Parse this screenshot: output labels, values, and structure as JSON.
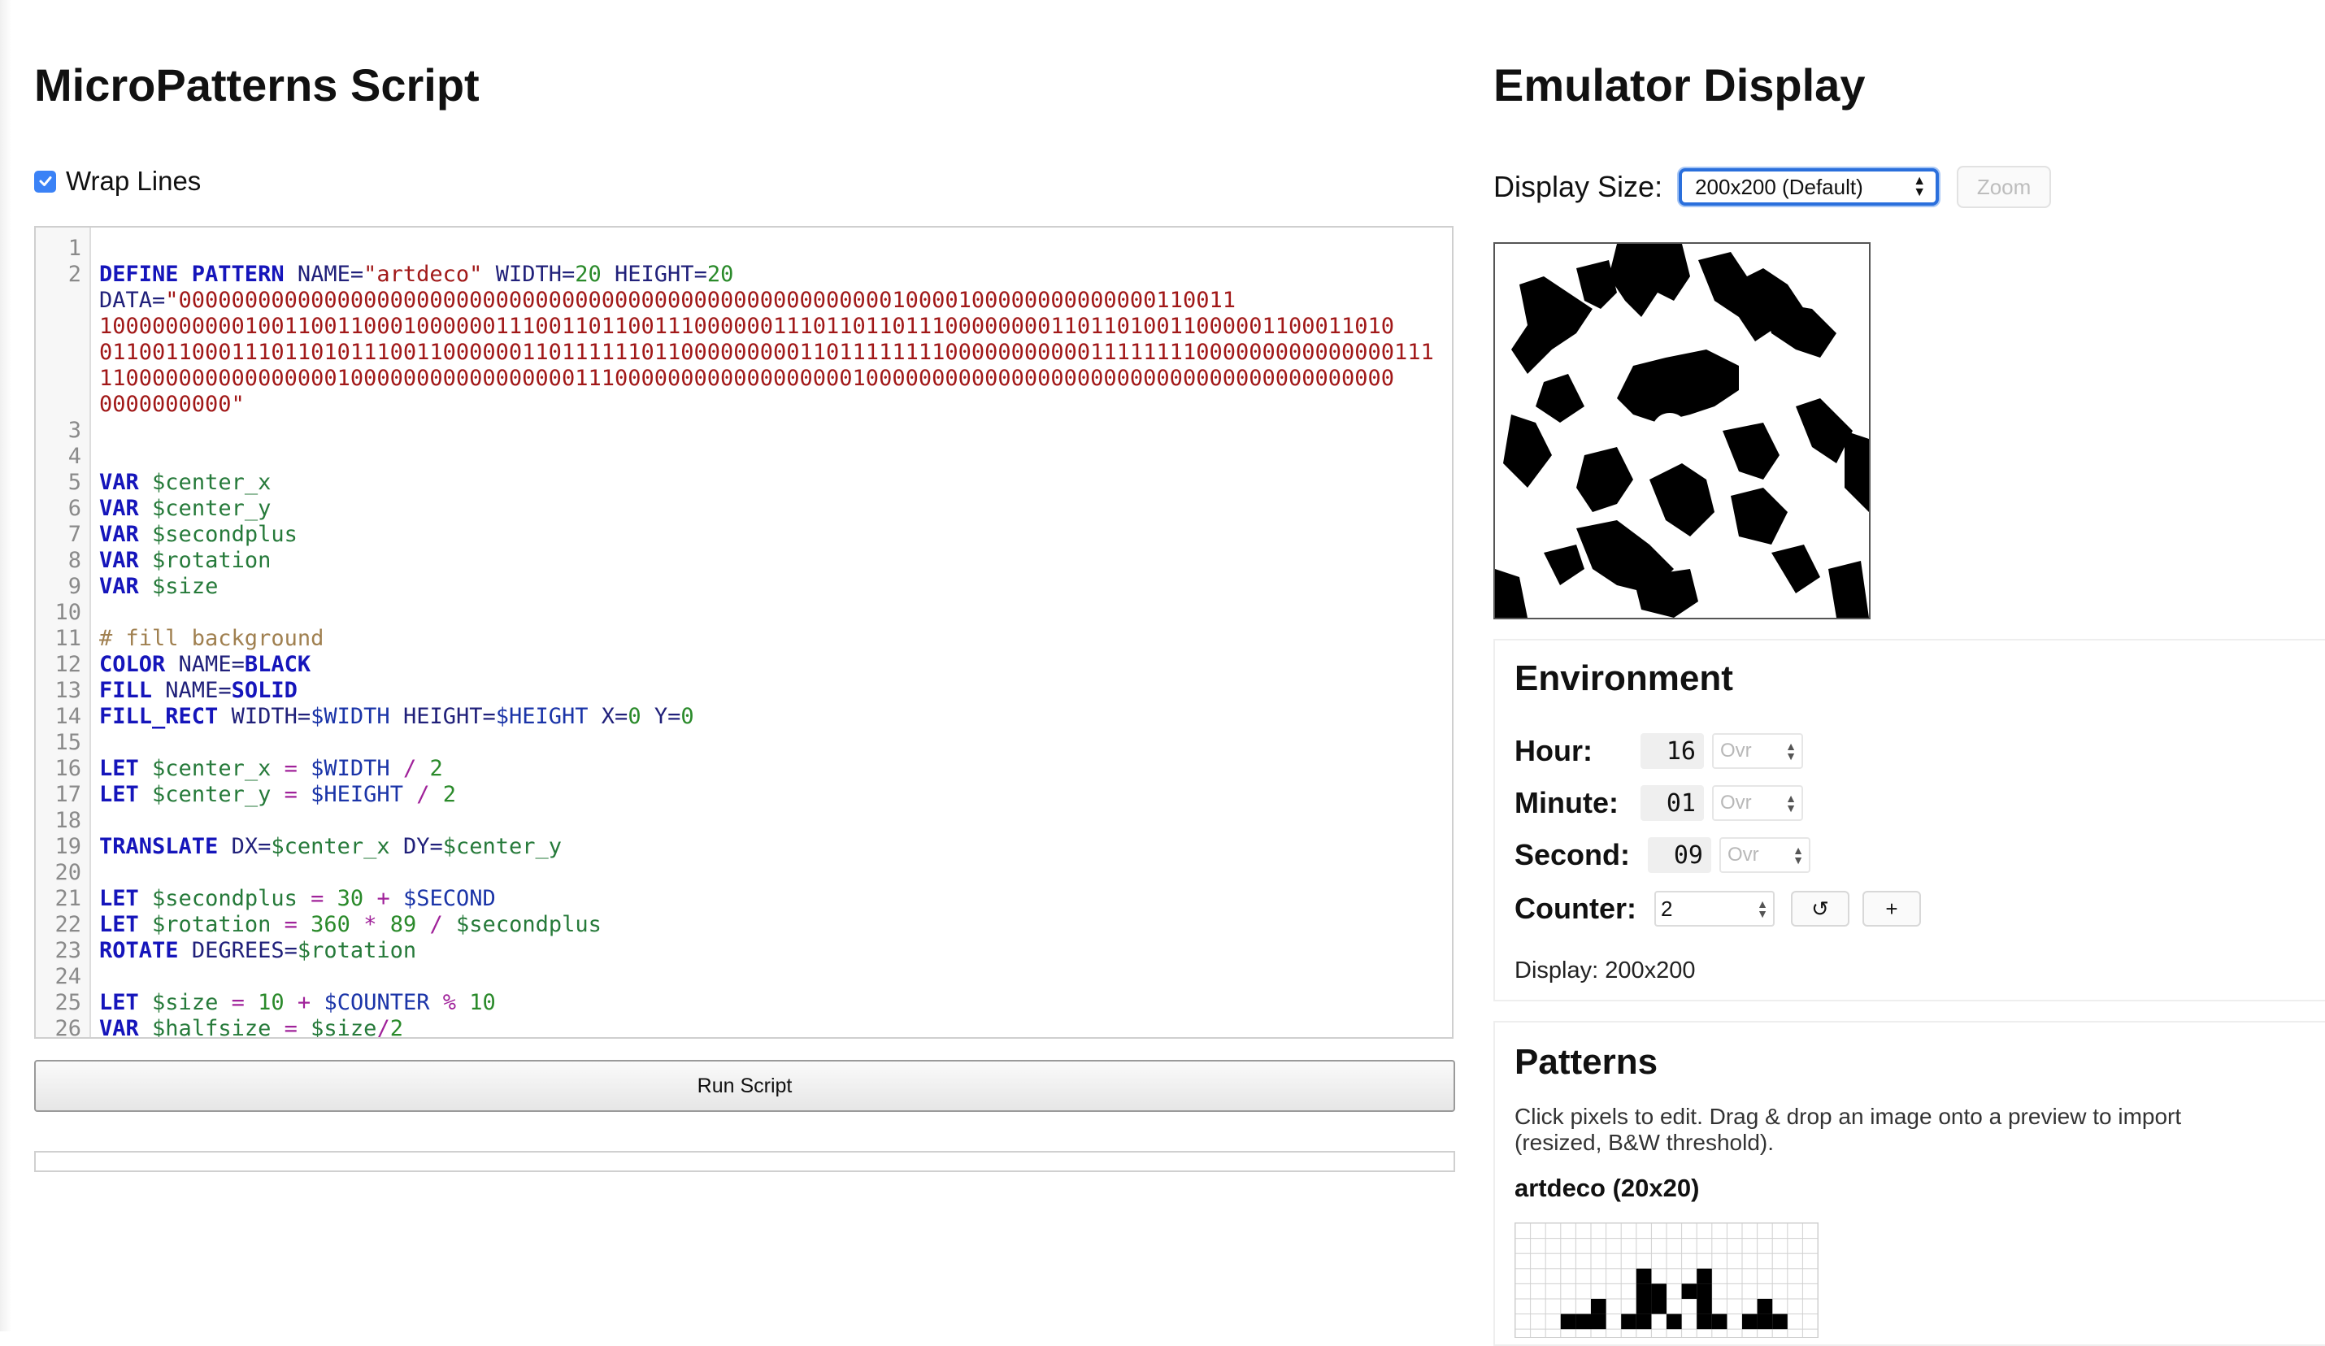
{
  "script_panel": {
    "title": "MicroPatterns Script",
    "wrap_lines_label": "Wrap Lines",
    "wrap_lines_checked": true,
    "run_button_label": "Run Script",
    "line_numbers": [
      "1",
      "2",
      "3",
      "4",
      "5",
      "6",
      "7",
      "8",
      "9",
      "10",
      "11",
      "12",
      "13",
      "14",
      "15",
      "16",
      "17",
      "18",
      "19",
      "20",
      "21",
      "22",
      "23",
      "24",
      "25",
      "26"
    ],
    "code": {
      "l2_kw": "DEFINE PATTERN",
      "l2_name_key": "NAME=",
      "l2_name_val": "\"artdeco\"",
      "l2_w_key": "WIDTH=",
      "l2_w_val": "20",
      "l2_h_key": "HEIGHT=",
      "l2_h_val": "20",
      "l2_data_key": "DATA=",
      "l2_data_1": "\"00000000000000000000000000000000000000000000000000000010000100000000000000110011",
      "l2_data_2": "10000000000100110011000100000011100110110011100000011101101101110000000011011010011000001100011010",
      "l2_data_3": "01100110001110110101110011000000110111111011000000000110111111110000000000011111111000000000000000111",
      "l2_data_4": "11000000000000000010000000000000000011100000000000000000010000000000000000000000000000000000000000",
      "l2_data_5": "0000000000\"",
      "var_kw": "VAR",
      "var_center_x": "$center_x",
      "var_center_y": "$center_y",
      "var_secondplus": "$secondplus",
      "var_rotation": "$rotation",
      "var_size": "$size",
      "comment_fill": "# fill background",
      "color_kw": "COLOR",
      "color_key": "NAME=",
      "color_val": "BLACK",
      "fill_kw": "FILL",
      "fill_key": "NAME=",
      "fill_val": "SOLID",
      "fillrect_kw": "FILL_RECT",
      "fillrect_w": "WIDTH=",
      "fillrect_wv": "$WIDTH",
      "fillrect_h": "HEIGHT=",
      "fillrect_hv": "$HEIGHT",
      "fillrect_x": "X=",
      "fillrect_xv": "0",
      "fillrect_y": "Y=",
      "fillrect_yv": "0",
      "let_kw": "LET",
      "l16_var": "$center_x",
      "l16_eq": "=",
      "l16_w": "$WIDTH",
      "l16_div": "/",
      "l16_n": "2",
      "l17_var": "$center_y",
      "l17_eq": "=",
      "l17_h": "$HEIGHT",
      "l17_div": "/",
      "l17_n": "2",
      "translate_kw": "TRANSLATE",
      "translate_dx": "DX=",
      "translate_dxv": "$center_x",
      "translate_dy": "DY=",
      "translate_dyv": "$center_y",
      "l21_var": "$secondplus",
      "l21_eq": "=",
      "l21_n": "30",
      "l21_plus": "+",
      "l21_s": "$SECOND",
      "l22_var": "$rotation",
      "l22_eq": "=",
      "l22_n1": "360",
      "l22_mul": "*",
      "l22_n2": "89",
      "l22_div": "/",
      "l22_v": "$secondplus",
      "rotate_kw": "ROTATE",
      "rotate_key": "DEGREES=",
      "rotate_val": "$rotation",
      "l25_var": "$size",
      "l25_eq": "=",
      "l25_n": "10",
      "l25_plus": "+",
      "l25_c": "$COUNTER",
      "l25_mod": "%",
      "l25_n2": "10",
      "l26_var": "$halfsize",
      "l26_eq": "=",
      "l26_s": "$size",
      "l26_div": "/",
      "l26_n": "2"
    }
  },
  "emulator": {
    "title": "Emulator Display",
    "display_size_label": "Display Size:",
    "display_size_value": "200x200 (Default)",
    "zoom_label": "Zoom"
  },
  "environment": {
    "title": "Environment",
    "hour_label": "Hour:",
    "hour_value": "16",
    "minute_label": "Minute:",
    "minute_value": "01",
    "second_label": "Second:",
    "second_value": "09",
    "override_placeholder": "Ovr",
    "counter_label": "Counter:",
    "counter_value": "2",
    "reset_symbol": "↺",
    "increment_symbol": "+",
    "display_info": "Display: 200x200"
  },
  "patterns": {
    "title": "Patterns",
    "help_text": "Click pixels to edit. Drag & drop an image onto a preview to import (resized, B&W threshold).",
    "pattern_name": "artdeco (20x20)"
  },
  "colors": {
    "keyword": "#1515bb",
    "string": "#a11818",
    "number": "#2a8a2a",
    "variable": "#267a3a",
    "operator": "#a0229a",
    "comment": "#a08050",
    "accent": "#2a6fdc"
  }
}
